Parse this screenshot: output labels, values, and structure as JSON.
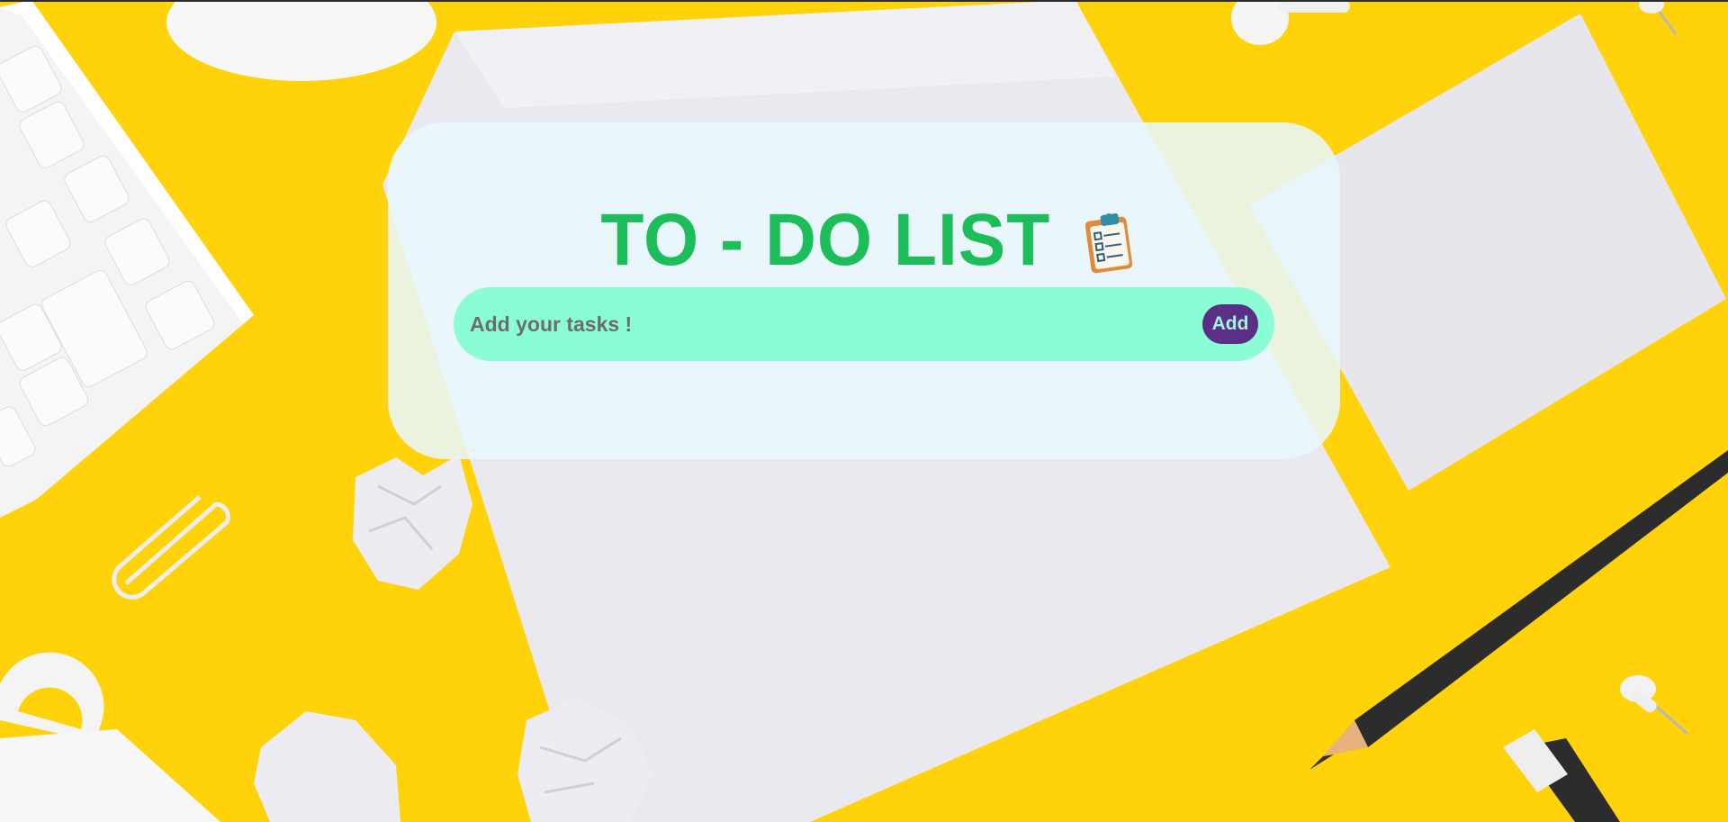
{
  "app": {
    "title": "TO - DO LIST",
    "title_icon": "clipboard-icon"
  },
  "task_form": {
    "input_value": "",
    "input_placeholder": "Add your tasks !",
    "add_label": "Add"
  },
  "colors": {
    "background": "#ffd20a",
    "card": "#e8f7fd",
    "title": "#1dbd5a",
    "input_bar": "#8bfdd5",
    "add_button": "#5b2f86",
    "add_button_text": "#9ff4e2"
  }
}
